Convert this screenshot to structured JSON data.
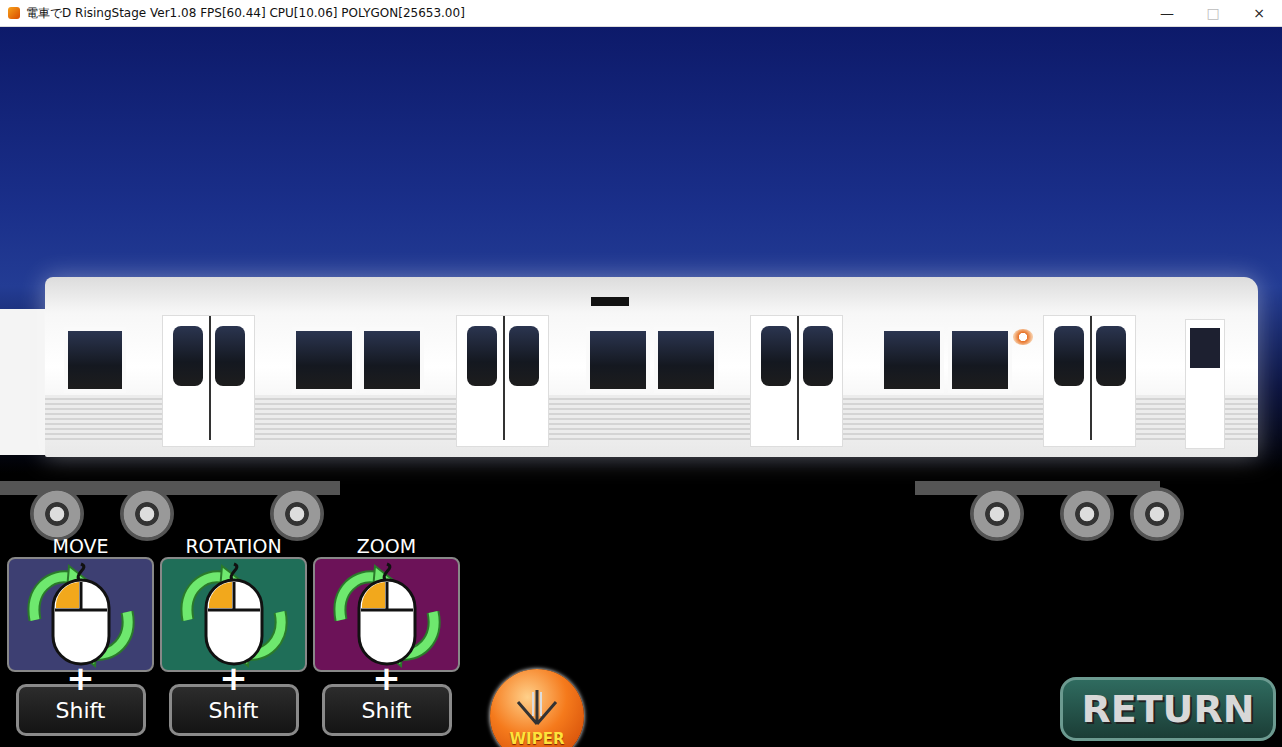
{
  "window": {
    "title": "電車でD RisingStage Ver1.08 FPS[60.44] CPU[10.06] POLYGON[25653.00]",
    "controls": [
      "—",
      "□",
      "×"
    ]
  },
  "controls": [
    {
      "label": "MOVE",
      "plus": "+",
      "modifier": "Shift",
      "color": "#3d3f72"
    },
    {
      "label": "ROTATION",
      "plus": "+",
      "modifier": "Shift",
      "color": "#1f6e58"
    },
    {
      "label": "ZOOM",
      "plus": "+",
      "modifier": "Shift",
      "color": "#6c1258"
    }
  ],
  "wiper": {
    "label": "WIPER"
  },
  "return_button": {
    "label": "RETURN"
  }
}
